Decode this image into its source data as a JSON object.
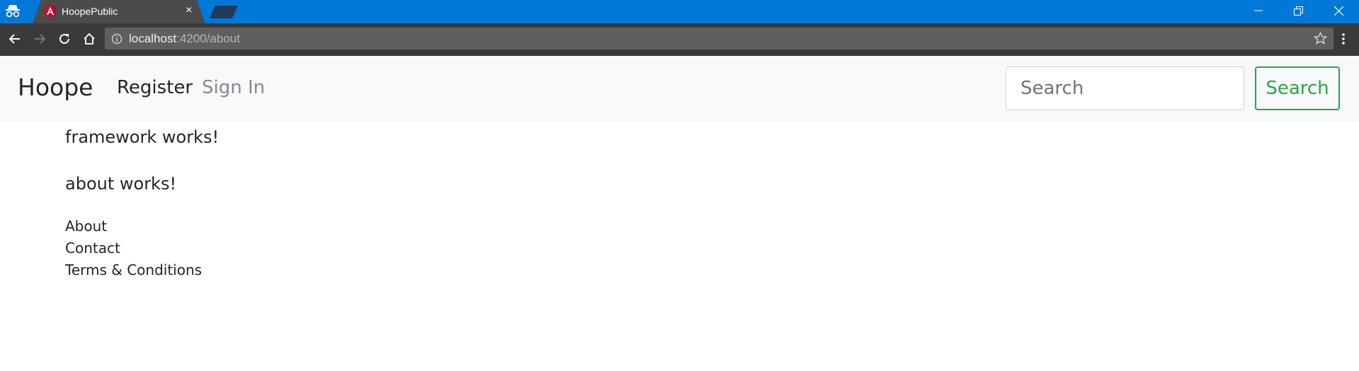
{
  "browser": {
    "tab_title": "HoopePublic",
    "tab_close": "×",
    "url_host": "localhost",
    "url_path": ":4200/about",
    "icons": {
      "incognito": "incognito-icon",
      "favicon": "angular-logo-icon",
      "back": "back-arrow-icon",
      "forward": "forward-arrow-icon",
      "reload": "reload-icon",
      "home": "home-icon",
      "info": "info-icon",
      "bookmark": "star-icon",
      "menu": "kebab-menu-icon"
    }
  },
  "navbar": {
    "brand": "Hoope",
    "links": [
      "Register",
      "Sign In"
    ],
    "search_placeholder": "Search",
    "search_button": "Search"
  },
  "content": {
    "framework_heading": "framework works!",
    "about_heading": "about works!",
    "footer_links": [
      "About",
      "Contact",
      "Terms & Conditions"
    ]
  },
  "colors": {
    "titlebar": "#0078d7",
    "navbar_bg": "#f8f9fa",
    "success": "#28a745",
    "text": "#212529",
    "muted_link": "#858a8f"
  }
}
